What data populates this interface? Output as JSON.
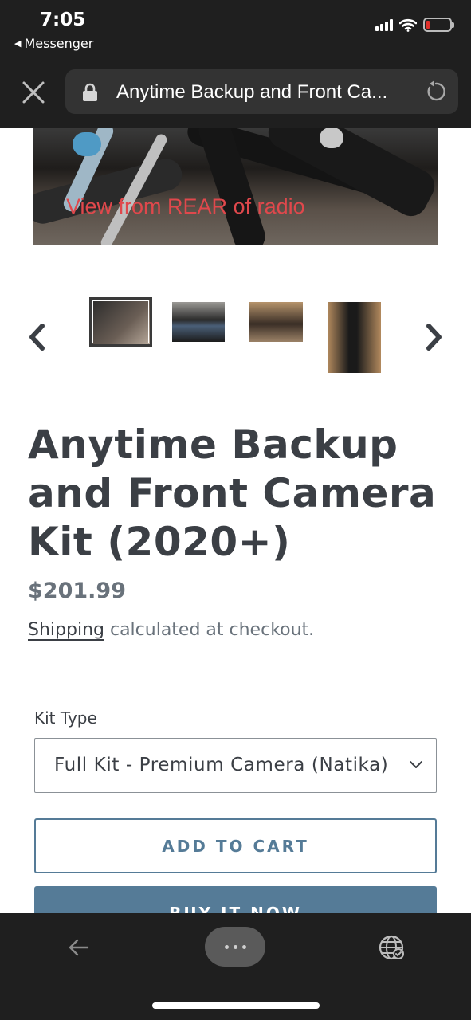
{
  "status_bar": {
    "time": "7:05",
    "back_app": "Messenger"
  },
  "browser": {
    "url_title": "Anytime Backup and Front Ca..."
  },
  "product": {
    "hero_caption": "View from REAR of radio",
    "title": "Anytime Backup and Front Camera Kit (2020+)",
    "price": "$201.99",
    "shipping_link": "Shipping",
    "shipping_text": " calculated at checkout.",
    "variant_label": "Kit Type",
    "variant_value": "Full Kit - Premium Camera (Natika)",
    "add_to_cart": "ADD TO CART",
    "buy_now": "BUY IT NOW"
  },
  "colors": {
    "accent": "#557b97",
    "heading": "#3b3f45",
    "muted": "#69727b",
    "chrome": "#1f1f1f",
    "caption_red": "#e0484c"
  },
  "icons": [
    "back-triangle-icon",
    "signal-icon",
    "wifi-icon",
    "battery-icon",
    "close-icon",
    "lock-icon",
    "reload-icon",
    "chevron-left-icon",
    "chevron-right-icon",
    "chevron-down-icon",
    "arrow-left-icon",
    "more-icon",
    "globe-icon"
  ]
}
